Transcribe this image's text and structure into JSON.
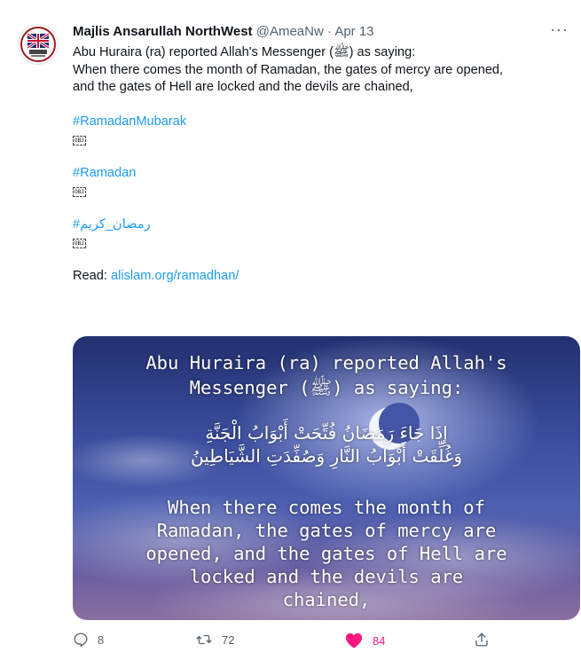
{
  "tweet": {
    "author_name": "Majlis Ansarullah NorthWest",
    "handle": "@AmeaNw",
    "separator": "·",
    "date": "Apr 13",
    "more_label": "···",
    "body_lines": [
      "Abu Huraira (ra) reported Allah's Messenger (ﷺ) as saying:",
      "When there comes the month of Ramadan, the gates of mercy are opened,",
      "and the gates of Hell are locked and the devils are chained,"
    ],
    "hashtags": [
      "#RamadanMubarak",
      "#Ramadan",
      "#رمضان_كريم"
    ],
    "obj_label": "OBJ",
    "read_prefix": "Read:",
    "read_link": "alislam.org/ramadhan/"
  },
  "media": {
    "title_lines": [
      "Abu Huraira (ra) reported Allah's",
      "Messenger (ﷺ) as saying:"
    ],
    "arabic_lines": [
      "إِذَا جَاءَ رَمَضَانُ فُتِّحَتْ أَبْوَابُ الْجَنَّةِ",
      "وَغُلِّقَتْ أَبْوَابُ النَّارِ وَصُفِّدَتِ الشَّيَاطِينُ"
    ],
    "english_lines": [
      "When there comes the month of",
      "Ramadan, the gates of mercy are",
      "opened, and the gates of Hell are",
      "locked and the devils are",
      "chained,"
    ]
  },
  "actions": {
    "reply_count": "8",
    "retweet_count": "72",
    "like_count": "84"
  },
  "colors": {
    "accent": "#1d9bf0",
    "like": "#f91880",
    "secondary_text": "#536471"
  },
  "icons": [
    "reply-icon",
    "retweet-icon",
    "heart-icon",
    "share-icon",
    "more-icon"
  ]
}
